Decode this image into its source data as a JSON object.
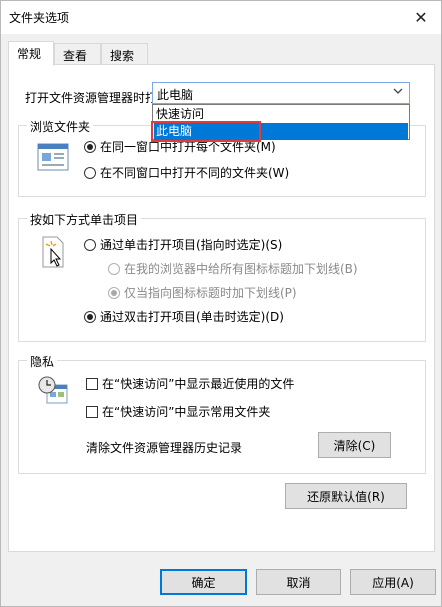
{
  "window": {
    "title": "文件夹选项",
    "close_glyph": "✕"
  },
  "tabs": [
    {
      "label": "常规",
      "active": true
    },
    {
      "label": "查看",
      "active": false
    },
    {
      "label": "搜索",
      "active": false
    }
  ],
  "open_explorer": {
    "label": "打开文件资源管理器时打",
    "selected": "此电脑",
    "options": [
      "快速访问",
      "此电脑"
    ]
  },
  "browse": {
    "legend": "浏览文件夹",
    "options": [
      {
        "label": "在同一窗口中打开每个文件夹(M)",
        "checked": true
      },
      {
        "label": "在不同窗口中打开不同的文件夹(W)",
        "checked": false
      }
    ]
  },
  "click": {
    "legend": "按如下方式单击项目",
    "single": "通过单击打开项目(指向时选定)(S)",
    "sub1": "在我的浏览器中给所有图标标题加下划线(B)",
    "sub2": "仅当指向图标标题时加下划线(P)",
    "double": "通过双击打开项目(单击时选定)(D)"
  },
  "privacy": {
    "legend": "隐私",
    "recent_files": "在“快速访问”中显示最近使用的文件",
    "frequent_folders": "在“快速访问”中显示常用文件夹",
    "clear_label": "清除文件资源管理器历史记录",
    "clear_button": "清除(C)"
  },
  "restore_button": "还原默认值(R)",
  "footer": {
    "ok": "确定",
    "cancel": "取消",
    "apply": "应用(A)"
  },
  "colors": {
    "accent": "#0078d7",
    "highlight_box": "#e23b3b"
  }
}
